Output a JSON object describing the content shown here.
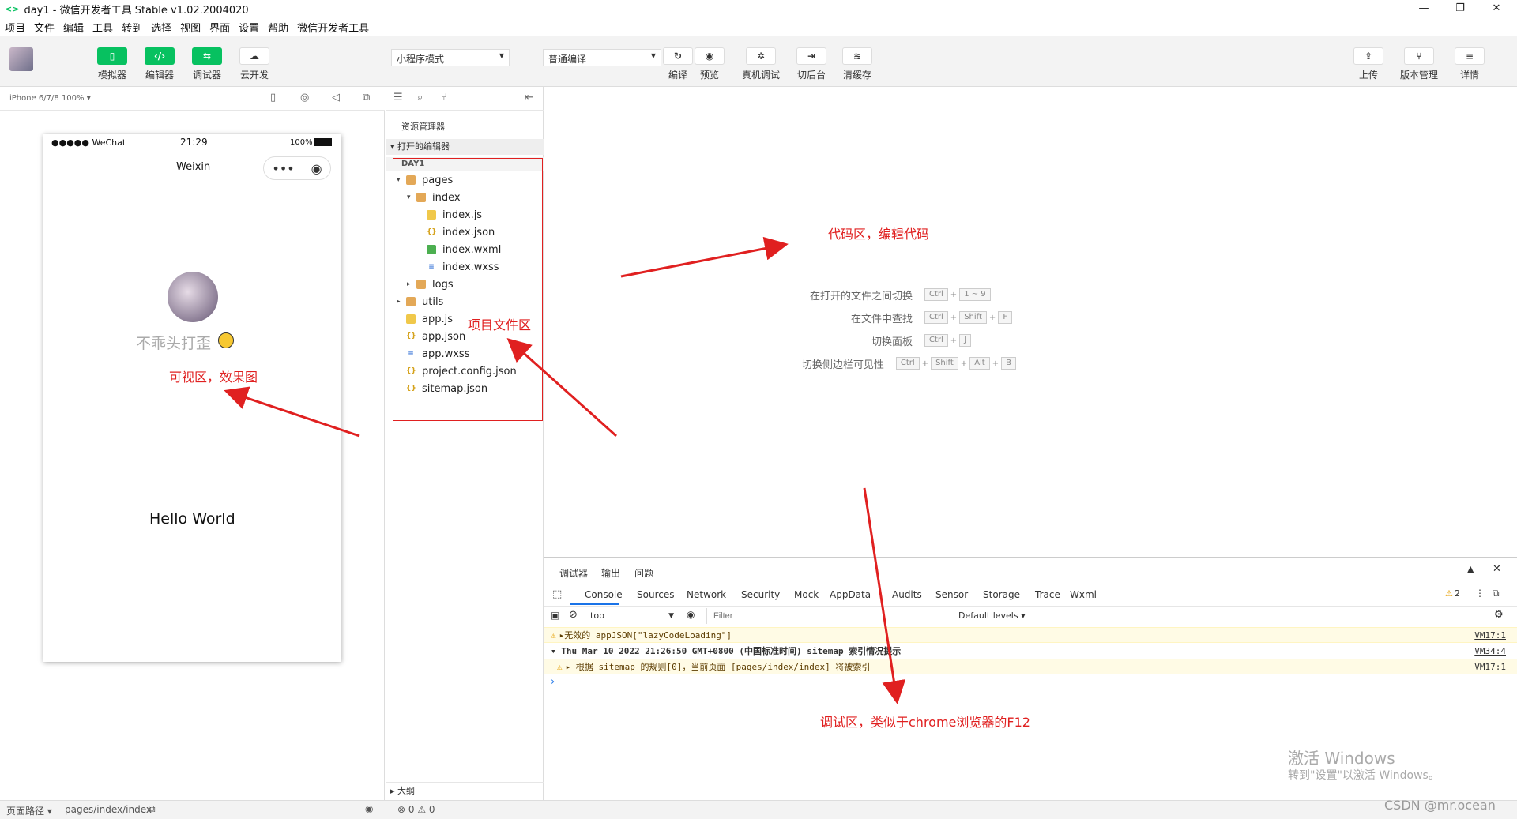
{
  "window": {
    "title": "day1 - 微信开发者工具 Stable v1.02.2004020",
    "logo": "<>"
  },
  "window_controls": {
    "minimize": "—",
    "restore": "❐",
    "close": "✕"
  },
  "menu": [
    "项目",
    "文件",
    "编辑",
    "工具",
    "转到",
    "选择",
    "视图",
    "界面",
    "设置",
    "帮助",
    "微信开发者工具"
  ],
  "toolbar": {
    "simulator": "模拟器",
    "editor": "编辑器",
    "debugger": "调试器",
    "cloud": "云开发",
    "mode_select": "小程序模式",
    "compile_select": "普通编译",
    "compile": "编译",
    "preview": "预览",
    "real_debug": "真机调试",
    "background": "切后台",
    "clear_cache": "清缓存",
    "upload": "上传",
    "version": "版本管理",
    "details": "详情"
  },
  "simulator": {
    "device": "iPhone 6/7/8 100% ▾",
    "status_left": "●●●●● WeChat",
    "status_time": "21:29",
    "status_battery": "100%",
    "nav_title": "Weixin",
    "nickname": "不乖头打歪",
    "hello": "Hello World"
  },
  "explorer": {
    "title": "资源管理器",
    "open_editors": "打开的编辑器",
    "project": "DAY1",
    "outline": "大纲",
    "items": [
      {
        "label": "pages",
        "icon": "folder-icon",
        "arrow": "▾"
      },
      {
        "label": "index",
        "icon": "folder-icon",
        "arrow": "▾"
      },
      {
        "label": "index.js",
        "icon": "js-file-icon",
        "arrow": ""
      },
      {
        "label": "index.json",
        "icon": "json-file-icon",
        "arrow": ""
      },
      {
        "label": "index.wxml",
        "icon": "wxml-file-icon",
        "arrow": ""
      },
      {
        "label": "index.wxss",
        "icon": "wxss-file-icon",
        "arrow": ""
      },
      {
        "label": "logs",
        "icon": "folder-icon",
        "arrow": "▸"
      },
      {
        "label": "utils",
        "icon": "folder-icon",
        "arrow": "▸"
      },
      {
        "label": "app.js",
        "icon": "js-file-icon",
        "arrow": ""
      },
      {
        "label": "app.json",
        "icon": "json-file-icon",
        "arrow": ""
      },
      {
        "label": "app.wxss",
        "icon": "wxss-file-icon",
        "arrow": ""
      },
      {
        "label": "project.config.json",
        "icon": "json-file-icon",
        "arrow": ""
      },
      {
        "label": "sitemap.json",
        "icon": "json-file-icon",
        "arrow": ""
      }
    ]
  },
  "editor": {
    "shortcuts": [
      {
        "label": "在打开的文件之间切换",
        "keys": [
          "Ctrl",
          "1 ~ 9"
        ]
      },
      {
        "label": "在文件中查找",
        "keys": [
          "Ctrl",
          "Shift",
          "F"
        ]
      },
      {
        "label": "切换面板",
        "keys": [
          "Ctrl",
          "J"
        ]
      },
      {
        "label": "切换侧边栏可见性",
        "keys": [
          "Ctrl",
          "Shift",
          "Alt",
          "B"
        ]
      }
    ]
  },
  "debugger": {
    "top_tabs": [
      "调试器",
      "输出",
      "问题"
    ],
    "tabs": [
      "Console",
      "Sources",
      "Network",
      "Security",
      "Mock",
      "AppData",
      "Audits",
      "Sensor",
      "Storage",
      "Trace",
      "Wxml"
    ],
    "warn_count": "2",
    "context": "top",
    "filter_placeholder": "Filter",
    "levels": "Default levels ▾",
    "logs": [
      {
        "text": "▸无效的 appJSON[\"lazyCodeLoading\"]",
        "src": "VM17:1",
        "type": "warn"
      },
      {
        "text": "▾ Thu Mar 10 2022 21:26:50 GMT+0800 (中国标准时间) sitemap 索引情况提示",
        "src": "VM34:4",
        "type": "group"
      },
      {
        "text": "▸ 根据 sitemap 的规则[0]，当前页面 [pages/index/index] 将被索引",
        "src": "VM17:1",
        "type": "warn"
      }
    ],
    "prompt": "›"
  },
  "status": {
    "path_label": "页面路径 ▾",
    "path": "pages/index/index",
    "issues": "⊗ 0 ⚠ 0"
  },
  "annotations": {
    "code": "代码区，编辑代码",
    "files": "项目文件区",
    "view": "可视区，效果图",
    "debug": "调试区，类似于chrome浏览器的F12"
  },
  "watermark": {
    "line1": "激活 Windows",
    "line2": "转到\"设置\"以激活 Windows。",
    "csdn": "CSDN @mr.ocean"
  },
  "colors": {
    "accent": "#07c160",
    "annotation": "#e02020"
  }
}
